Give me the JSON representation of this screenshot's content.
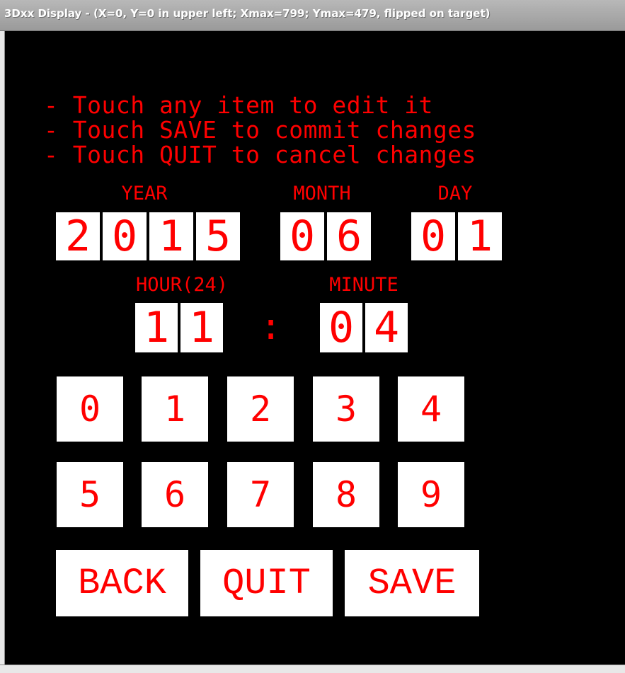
{
  "window": {
    "title": "3Dxx Display - (X=0, Y=0 in upper left; Xmax=799; Ymax=479, flipped on target)"
  },
  "instructions": [
    "- Touch any item to edit it",
    "- Touch SAVE to commit changes",
    "- Touch QUIT to cancel changes"
  ],
  "date": {
    "year_label": "YEAR",
    "month_label": "MONTH",
    "day_label": "DAY",
    "year_digits": [
      "2",
      "0",
      "1",
      "5"
    ],
    "month_digits": [
      "0",
      "6"
    ],
    "day_digits": [
      "0",
      "1"
    ]
  },
  "time": {
    "hour_label": "HOUR(24)",
    "minute_label": "MINUTE",
    "separator": ":",
    "hour_digits": [
      "1",
      "1"
    ],
    "minute_digits": [
      "0",
      "4"
    ]
  },
  "keypad": {
    "keys": [
      "0",
      "1",
      "2",
      "3",
      "4",
      "5",
      "6",
      "7",
      "8",
      "9"
    ]
  },
  "actions": {
    "back_label": "BACK",
    "quit_label": "QUIT",
    "save_label": "SAVE"
  },
  "colors": {
    "text": "#ff0000",
    "background": "#000000",
    "cell_background": "#ffffff"
  }
}
